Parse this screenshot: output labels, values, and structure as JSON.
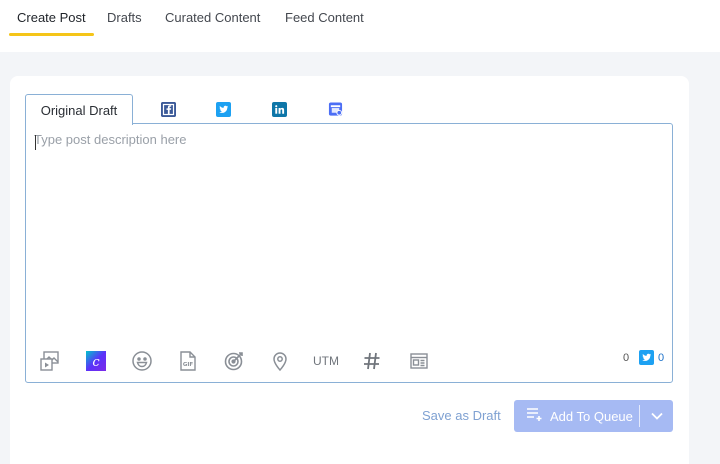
{
  "topnav": {
    "tabs": [
      {
        "label": "Create Post"
      },
      {
        "label": "Drafts"
      },
      {
        "label": "Curated Content"
      },
      {
        "label": "Feed Content"
      }
    ]
  },
  "editor": {
    "tab_original": "Original Draft",
    "networks": [
      "facebook-icon",
      "twitter-icon",
      "linkedin-icon",
      "google-business-icon"
    ],
    "placeholder": "Type post description here",
    "toolbar": {
      "utm_label": "UTM",
      "char_count": "0",
      "twitter_count": "0"
    }
  },
  "actions": {
    "save_draft": "Save as Draft",
    "add_to_queue": "Add To Queue"
  },
  "colors": {
    "accent_underline": "#f5c518",
    "facebook": "#3b5998",
    "twitter": "#1da1f2",
    "linkedin": "#0e76a8",
    "primary_button": "#a6baf3"
  }
}
